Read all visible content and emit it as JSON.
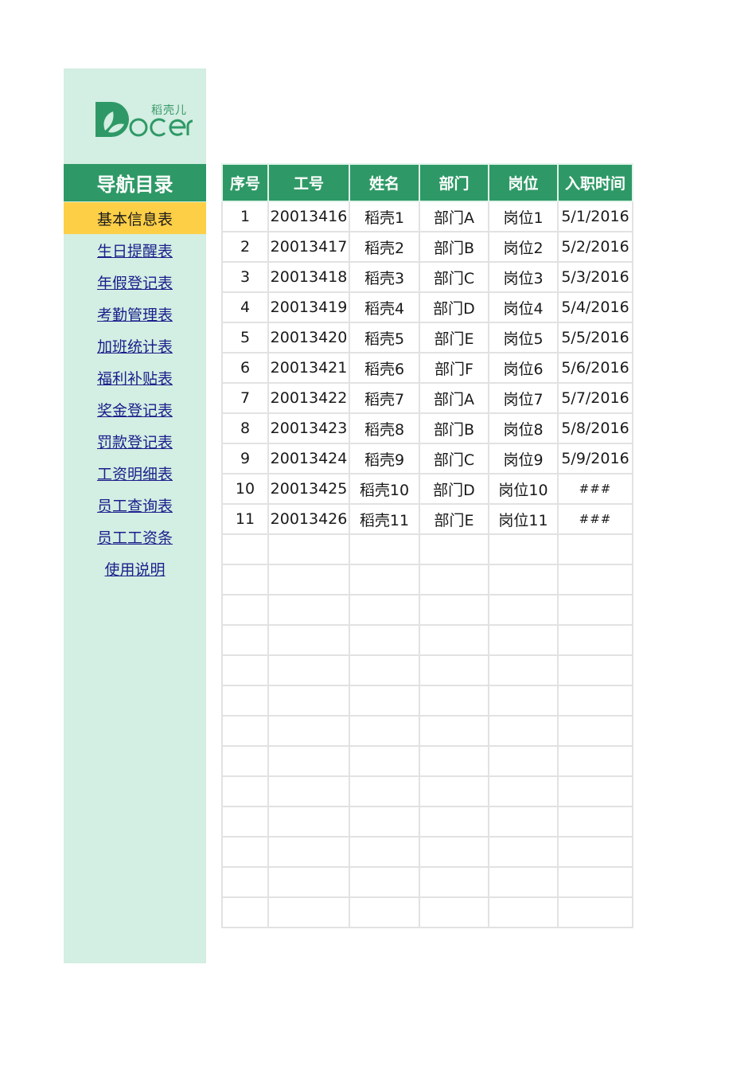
{
  "logo": {
    "brand": "Docer",
    "chinese": "稻壳儿",
    "brand_color": "#2e9966"
  },
  "sidebar": {
    "title": "导航目录",
    "items": [
      {
        "label": "基本信息表",
        "active": true
      },
      {
        "label": "生日提醒表"
      },
      {
        "label": "年假登记表"
      },
      {
        "label": "考勤管理表"
      },
      {
        "label": "加班统计表"
      },
      {
        "label": "福利补贴表"
      },
      {
        "label": "奖金登记表"
      },
      {
        "label": "罚款登记表"
      },
      {
        "label": "工资明细表"
      },
      {
        "label": "员工查询表"
      },
      {
        "label": "员工工资条"
      },
      {
        "label": "使用说明"
      }
    ]
  },
  "table": {
    "headers": [
      "序号",
      "工号",
      "姓名",
      "部门",
      "岗位",
      "入职时间"
    ],
    "rows": [
      [
        "1",
        "20013416",
        "稻壳1",
        "部门A",
        "岗位1",
        "5/1/2016"
      ],
      [
        "2",
        "20013417",
        "稻壳2",
        "部门B",
        "岗位2",
        "5/2/2016"
      ],
      [
        "3",
        "20013418",
        "稻壳3",
        "部门C",
        "岗位3",
        "5/3/2016"
      ],
      [
        "4",
        "20013419",
        "稻壳4",
        "部门D",
        "岗位4",
        "5/4/2016"
      ],
      [
        "5",
        "20013420",
        "稻壳5",
        "部门E",
        "岗位5",
        "5/5/2016"
      ],
      [
        "6",
        "20013421",
        "稻壳6",
        "部门F",
        "岗位6",
        "5/6/2016"
      ],
      [
        "7",
        "20013422",
        "稻壳7",
        "部门A",
        "岗位7",
        "5/7/2016"
      ],
      [
        "8",
        "20013423",
        "稻壳8",
        "部门B",
        "岗位8",
        "5/8/2016"
      ],
      [
        "9",
        "20013424",
        "稻壳9",
        "部门C",
        "岗位9",
        "5/9/2016"
      ],
      [
        "10",
        "20013425",
        "稻壳10",
        "部门D",
        "岗位10",
        "###"
      ],
      [
        "11",
        "20013426",
        "稻壳11",
        "部门E",
        "岗位11",
        "###"
      ]
    ],
    "empty_rows": 13
  },
  "colors": {
    "header_bg": "#2e9966",
    "sidebar_bg": "#d3eee2",
    "active_bg": "#fdcf47",
    "link": "#1b1f8c"
  }
}
